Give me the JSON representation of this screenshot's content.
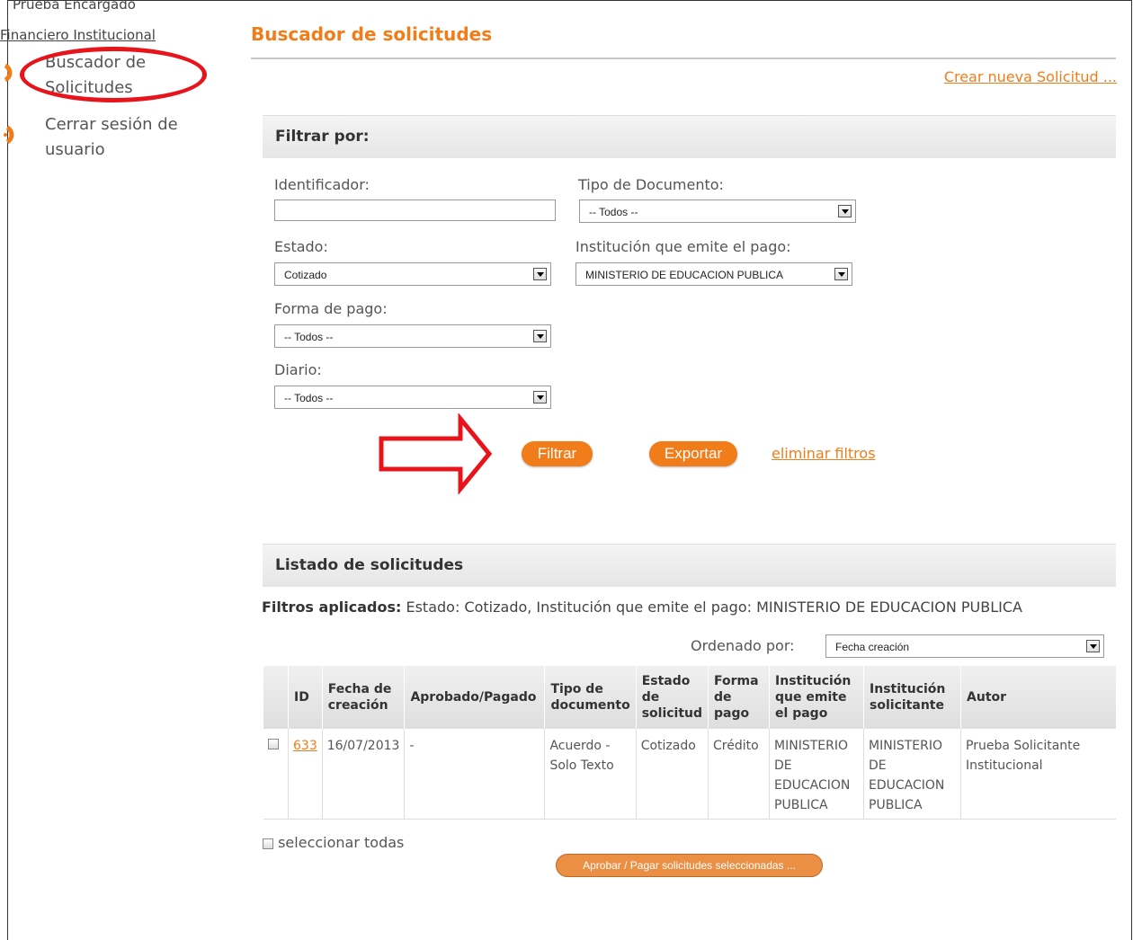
{
  "sidebar": {
    "user_line1": "Prueba Encargado",
    "user_line2": "Financiero Institucional",
    "items": [
      {
        "label_line1": "Buscador de",
        "label_line2": "Solicitudes"
      },
      {
        "label_line1": "Cerrar sesión de",
        "label_line2": "usuario"
      }
    ]
  },
  "header": {
    "title": "Buscador de solicitudes",
    "create_link": "Crear nueva Solicitud ..."
  },
  "filters": {
    "title": "Filtrar por:",
    "identificador_label": "Identificador:",
    "identificador_value": "",
    "tipo_doc_label": "Tipo de Documento:",
    "tipo_doc_value": "-- Todos --",
    "estado_label": "Estado:",
    "estado_value": "Cotizado",
    "institucion_label": "Institución que emite el pago:",
    "institucion_value": "MINISTERIO DE EDUCACION PUBLICA",
    "forma_pago_label": "Forma de pago:",
    "forma_pago_value": "-- Todos --",
    "diario_label": "Diario:",
    "diario_value": "-- Todos --",
    "filtrar_label": "Filtrar",
    "exportar_label": "Exportar",
    "eliminar_label": "eliminar filtros"
  },
  "list": {
    "title": "Listado de solicitudes",
    "applied_prefix": "Filtros aplicados:",
    "applied_text": "Estado: Cotizado, Institución que emite el pago: MINISTERIO DE EDUCACION PUBLICA",
    "order_label": "Ordenado por:",
    "order_value": "Fecha creación",
    "columns": [
      "ID",
      "Fecha de creación",
      "Aprobado/Pagado",
      "Tipo de documento",
      "Estado de solicitud",
      "Forma de pago",
      "Institución que emite el pago",
      "Institución solicitante",
      "Autor"
    ],
    "rows": [
      {
        "id": "633",
        "fecha": "16/07/2013",
        "aprobado": "-",
        "tipo": "Acuerdo - Solo Texto",
        "estado": "Cotizado",
        "forma": "Crédito",
        "inst_emite": "MINISTERIO DE EDUCACION PUBLICA",
        "inst_solicitante": "MINISTERIO DE EDUCACION PUBLICA",
        "autor": "Prueba Solicitante Institucional"
      }
    ],
    "select_all": "seleccionar todas",
    "approve_button": "Aprobar / Pagar solicitudes seleccionadas ..."
  },
  "colors": {
    "accent": "#f07d1a",
    "annotation": "#e8141b"
  }
}
